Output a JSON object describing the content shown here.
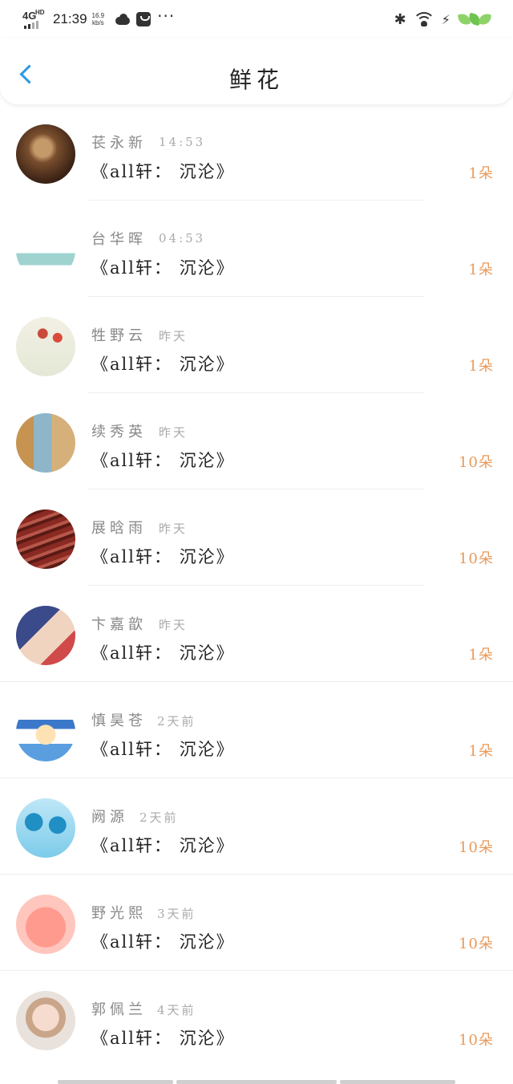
{
  "status_bar": {
    "network": "4G",
    "network_sup": "HD",
    "time": "21:39",
    "speed_value": "16.9",
    "speed_unit": "kb/s"
  },
  "nav": {
    "title": "鲜花"
  },
  "items": [
    {
      "name": "苌永新",
      "time": "14:53",
      "book": "《all轩： 沉沦》",
      "count": "1朵"
    },
    {
      "name": "台华晖",
      "time": "04:53",
      "book": "《all轩： 沉沦》",
      "count": "1朵"
    },
    {
      "name": "牲野云",
      "time": "昨天",
      "book": "《all轩： 沉沦》",
      "count": "1朵"
    },
    {
      "name": "续秀英",
      "time": "昨天",
      "book": "《all轩： 沉沦》",
      "count": "10朵"
    },
    {
      "name": "展晗雨",
      "time": "昨天",
      "book": "《all轩： 沉沦》",
      "count": "10朵"
    },
    {
      "name": "卞嘉歆",
      "time": "昨天",
      "book": "《all轩： 沉沦》",
      "count": "1朵"
    },
    {
      "name": "慎昊苍",
      "time": "2天前",
      "book": "《all轩： 沉沦》",
      "count": "1朵"
    },
    {
      "name": "阙源",
      "time": "2天前",
      "book": "《all轩： 沉沦》",
      "count": "10朵"
    },
    {
      "name": "野光熙",
      "time": "3天前",
      "book": "《all轩： 沉沦》",
      "count": "10朵"
    },
    {
      "name": "郭佩兰",
      "time": "4天前",
      "book": "《all轩： 沉沦》",
      "count": "10朵"
    }
  ],
  "colors": {
    "accent_blue": "#2b98e4",
    "count_orange": "#e89a5a"
  }
}
